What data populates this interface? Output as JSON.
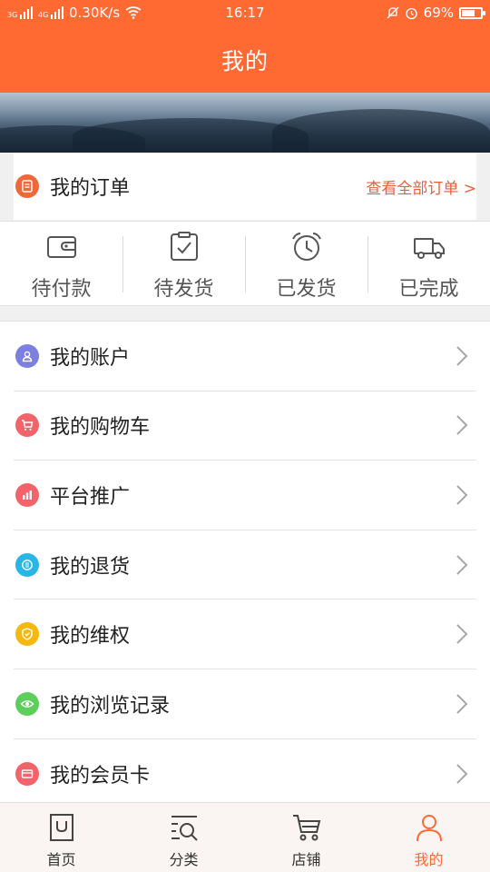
{
  "status_bar": {
    "network_speed": "0.30K/s",
    "time": "16:17",
    "battery": "69%",
    "battery_level": 0.69
  },
  "header": {
    "title": "我的"
  },
  "orders": {
    "title": "我的订单",
    "view_all": "查看全部订单 >",
    "statuses": [
      {
        "label": "待付款",
        "icon": "wallet-icon"
      },
      {
        "label": "待发货",
        "icon": "checklist-icon"
      },
      {
        "label": "已发货",
        "icon": "alarm-clock-icon"
      },
      {
        "label": "已完成",
        "icon": "truck-icon"
      }
    ]
  },
  "menu": {
    "items": [
      {
        "label": "我的账户",
        "icon": "user-icon",
        "color": "#7b7fe0"
      },
      {
        "label": "我的购物车",
        "icon": "cart-icon",
        "color": "#f2646a"
      },
      {
        "label": "平台推广",
        "icon": "bar-chart-icon",
        "color": "#f2646a"
      },
      {
        "label": "我的退货",
        "icon": "return-icon",
        "color": "#27b6e6"
      },
      {
        "label": "我的维权",
        "icon": "shield-icon",
        "color": "#f5b80f"
      },
      {
        "label": "我的浏览记录",
        "icon": "eye-icon",
        "color": "#5ccf5a"
      },
      {
        "label": "我的会员卡",
        "icon": "card-icon",
        "color": "#f2646a"
      }
    ]
  },
  "bottom_nav": {
    "items": [
      {
        "label": "首页",
        "icon": "home-bag-icon"
      },
      {
        "label": "分类",
        "icon": "category-search-icon"
      },
      {
        "label": "店铺",
        "icon": "shop-cart-icon"
      },
      {
        "label": "我的",
        "icon": "profile-icon",
        "active": true
      }
    ]
  },
  "colors": {
    "accent": "#ff6a33",
    "link": "#e5603a",
    "order_icon": "#f0683a"
  }
}
